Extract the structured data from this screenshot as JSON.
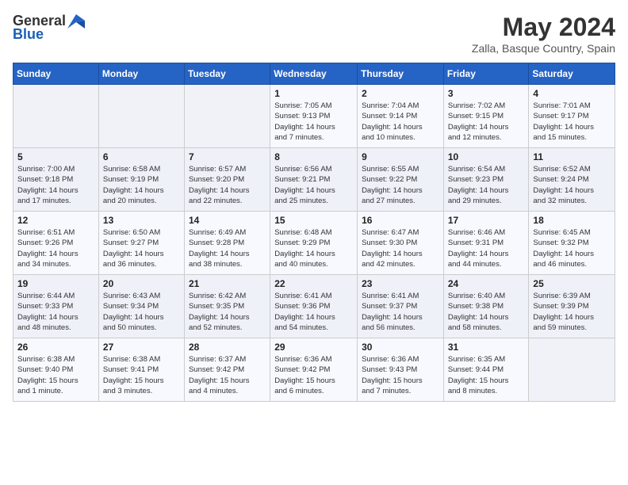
{
  "header": {
    "logo_general": "General",
    "logo_blue": "Blue",
    "month": "May 2024",
    "location": "Zalla, Basque Country, Spain"
  },
  "days_of_week": [
    "Sunday",
    "Monday",
    "Tuesday",
    "Wednesday",
    "Thursday",
    "Friday",
    "Saturday"
  ],
  "weeks": [
    [
      {
        "day": "",
        "info": ""
      },
      {
        "day": "",
        "info": ""
      },
      {
        "day": "",
        "info": ""
      },
      {
        "day": "1",
        "info": "Sunrise: 7:05 AM\nSunset: 9:13 PM\nDaylight: 14 hours\nand 7 minutes."
      },
      {
        "day": "2",
        "info": "Sunrise: 7:04 AM\nSunset: 9:14 PM\nDaylight: 14 hours\nand 10 minutes."
      },
      {
        "day": "3",
        "info": "Sunrise: 7:02 AM\nSunset: 9:15 PM\nDaylight: 14 hours\nand 12 minutes."
      },
      {
        "day": "4",
        "info": "Sunrise: 7:01 AM\nSunset: 9:17 PM\nDaylight: 14 hours\nand 15 minutes."
      }
    ],
    [
      {
        "day": "5",
        "info": "Sunrise: 7:00 AM\nSunset: 9:18 PM\nDaylight: 14 hours\nand 17 minutes."
      },
      {
        "day": "6",
        "info": "Sunrise: 6:58 AM\nSunset: 9:19 PM\nDaylight: 14 hours\nand 20 minutes."
      },
      {
        "day": "7",
        "info": "Sunrise: 6:57 AM\nSunset: 9:20 PM\nDaylight: 14 hours\nand 22 minutes."
      },
      {
        "day": "8",
        "info": "Sunrise: 6:56 AM\nSunset: 9:21 PM\nDaylight: 14 hours\nand 25 minutes."
      },
      {
        "day": "9",
        "info": "Sunrise: 6:55 AM\nSunset: 9:22 PM\nDaylight: 14 hours\nand 27 minutes."
      },
      {
        "day": "10",
        "info": "Sunrise: 6:54 AM\nSunset: 9:23 PM\nDaylight: 14 hours\nand 29 minutes."
      },
      {
        "day": "11",
        "info": "Sunrise: 6:52 AM\nSunset: 9:24 PM\nDaylight: 14 hours\nand 32 minutes."
      }
    ],
    [
      {
        "day": "12",
        "info": "Sunrise: 6:51 AM\nSunset: 9:26 PM\nDaylight: 14 hours\nand 34 minutes."
      },
      {
        "day": "13",
        "info": "Sunrise: 6:50 AM\nSunset: 9:27 PM\nDaylight: 14 hours\nand 36 minutes."
      },
      {
        "day": "14",
        "info": "Sunrise: 6:49 AM\nSunset: 9:28 PM\nDaylight: 14 hours\nand 38 minutes."
      },
      {
        "day": "15",
        "info": "Sunrise: 6:48 AM\nSunset: 9:29 PM\nDaylight: 14 hours\nand 40 minutes."
      },
      {
        "day": "16",
        "info": "Sunrise: 6:47 AM\nSunset: 9:30 PM\nDaylight: 14 hours\nand 42 minutes."
      },
      {
        "day": "17",
        "info": "Sunrise: 6:46 AM\nSunset: 9:31 PM\nDaylight: 14 hours\nand 44 minutes."
      },
      {
        "day": "18",
        "info": "Sunrise: 6:45 AM\nSunset: 9:32 PM\nDaylight: 14 hours\nand 46 minutes."
      }
    ],
    [
      {
        "day": "19",
        "info": "Sunrise: 6:44 AM\nSunset: 9:33 PM\nDaylight: 14 hours\nand 48 minutes."
      },
      {
        "day": "20",
        "info": "Sunrise: 6:43 AM\nSunset: 9:34 PM\nDaylight: 14 hours\nand 50 minutes."
      },
      {
        "day": "21",
        "info": "Sunrise: 6:42 AM\nSunset: 9:35 PM\nDaylight: 14 hours\nand 52 minutes."
      },
      {
        "day": "22",
        "info": "Sunrise: 6:41 AM\nSunset: 9:36 PM\nDaylight: 14 hours\nand 54 minutes."
      },
      {
        "day": "23",
        "info": "Sunrise: 6:41 AM\nSunset: 9:37 PM\nDaylight: 14 hours\nand 56 minutes."
      },
      {
        "day": "24",
        "info": "Sunrise: 6:40 AM\nSunset: 9:38 PM\nDaylight: 14 hours\nand 58 minutes."
      },
      {
        "day": "25",
        "info": "Sunrise: 6:39 AM\nSunset: 9:39 PM\nDaylight: 14 hours\nand 59 minutes."
      }
    ],
    [
      {
        "day": "26",
        "info": "Sunrise: 6:38 AM\nSunset: 9:40 PM\nDaylight: 15 hours\nand 1 minute."
      },
      {
        "day": "27",
        "info": "Sunrise: 6:38 AM\nSunset: 9:41 PM\nDaylight: 15 hours\nand 3 minutes."
      },
      {
        "day": "28",
        "info": "Sunrise: 6:37 AM\nSunset: 9:42 PM\nDaylight: 15 hours\nand 4 minutes."
      },
      {
        "day": "29",
        "info": "Sunrise: 6:36 AM\nSunset: 9:42 PM\nDaylight: 15 hours\nand 6 minutes."
      },
      {
        "day": "30",
        "info": "Sunrise: 6:36 AM\nSunset: 9:43 PM\nDaylight: 15 hours\nand 7 minutes."
      },
      {
        "day": "31",
        "info": "Sunrise: 6:35 AM\nSunset: 9:44 PM\nDaylight: 15 hours\nand 8 minutes."
      },
      {
        "day": "",
        "info": ""
      }
    ]
  ]
}
